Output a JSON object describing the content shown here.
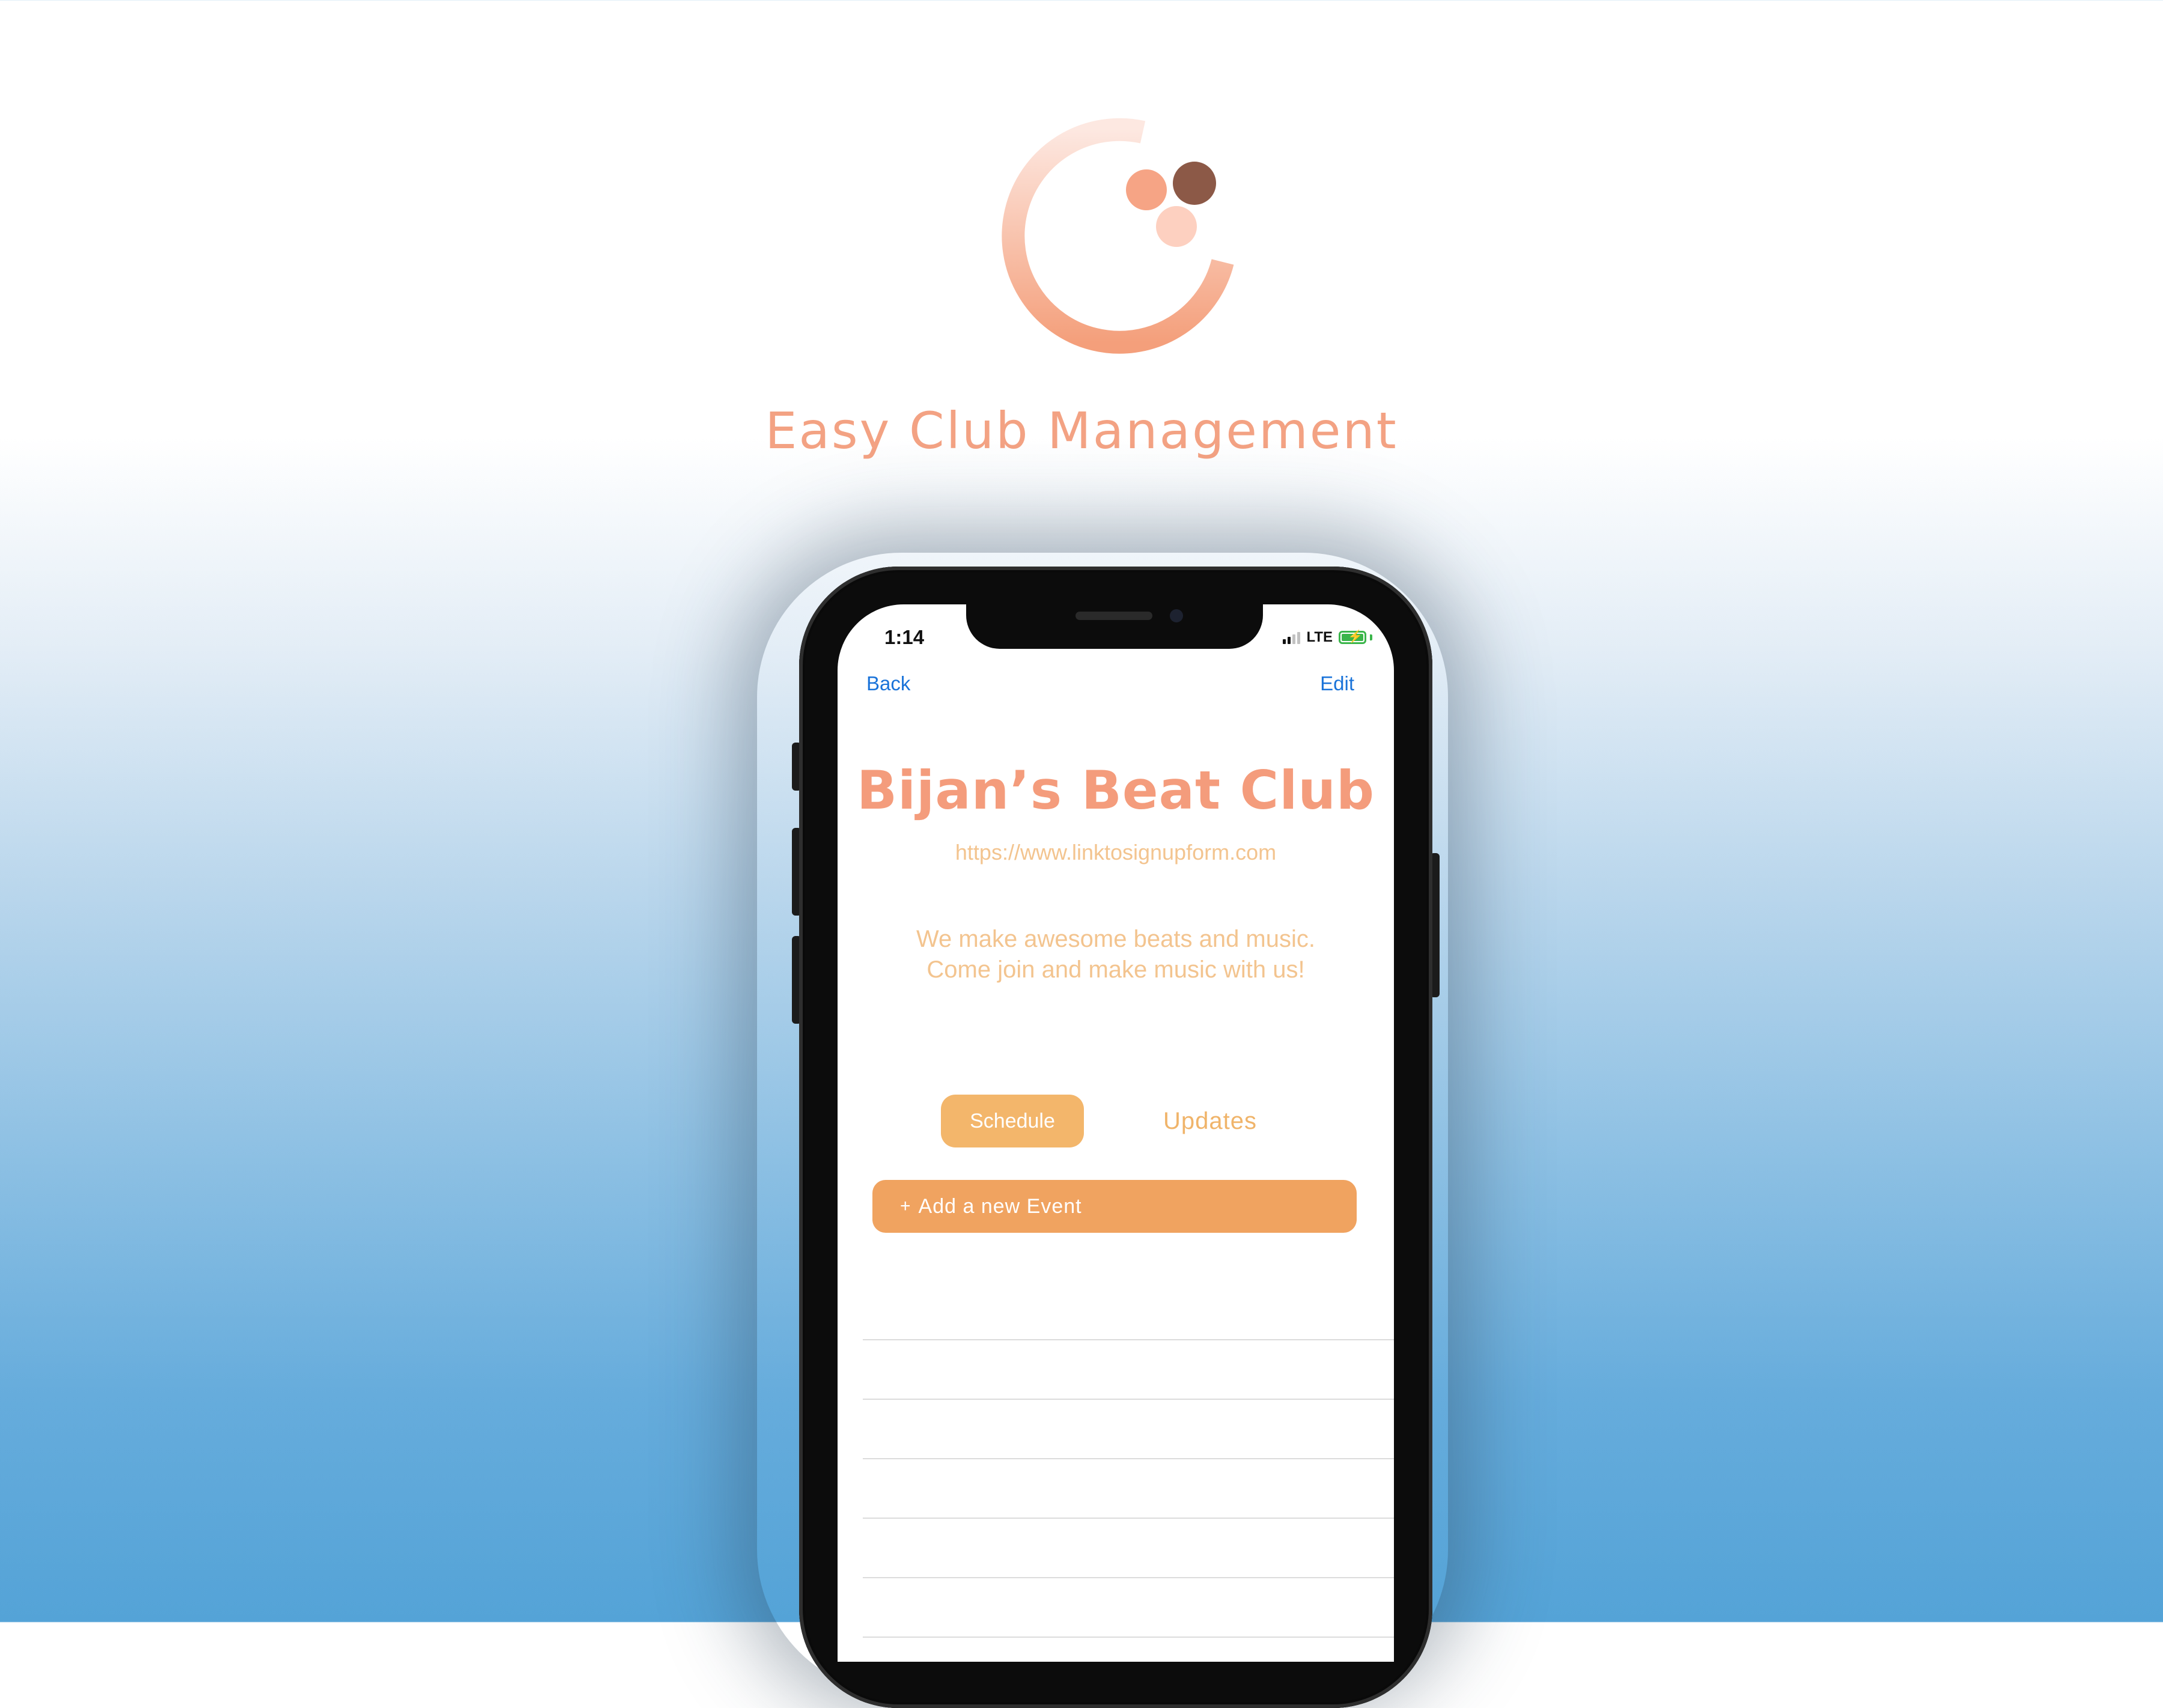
{
  "brand": {
    "tagline": "Easy Club Management",
    "logo_colors": {
      "ring_light": "#fde3da",
      "ring_dark": "#f4a07c",
      "dot_salmon": "#f6a485",
      "dot_brown": "#8c5947",
      "dot_pale": "#fdd0c0"
    }
  },
  "phone": {
    "status_bar": {
      "time": "1:14",
      "network": "LTE",
      "battery_state": "charging"
    },
    "nav": {
      "back_label": "Back",
      "edit_label": "Edit"
    },
    "club": {
      "title": "Bijan’s Beat Club",
      "link": "https://www.linktosignupform.com",
      "description": "We make awesome beats and music. Come join and make music with us!"
    },
    "tabs": [
      {
        "label": "Schedule",
        "selected": true
      },
      {
        "label": "Updates",
        "selected": false
      }
    ],
    "add_event": {
      "icon": "+",
      "label": "Add a new Event"
    },
    "event_rows": [
      {},
      {},
      {},
      {},
      {},
      {}
    ]
  },
  "colors": {
    "accent_title": "#f49c7c",
    "accent_text": "#f3c48f",
    "tab_selected_bg": "#f3b66b",
    "add_event_bg": "#f0a360",
    "link_blue": "#1a73d9"
  }
}
